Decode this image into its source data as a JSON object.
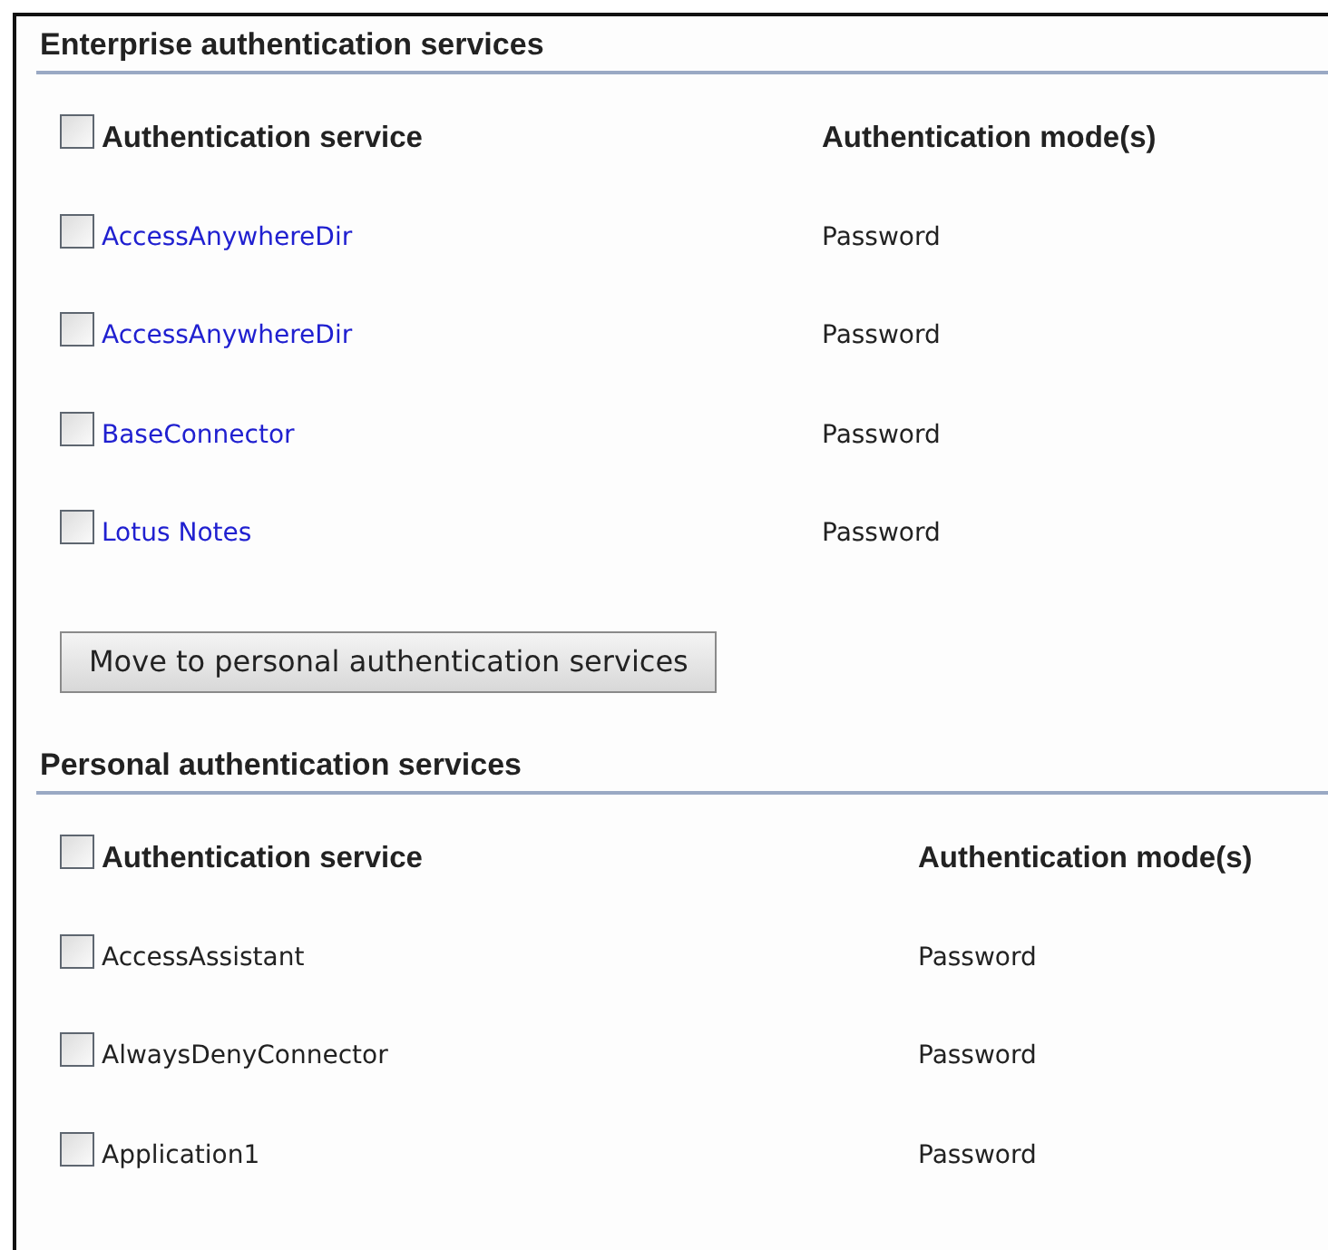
{
  "sections": [
    {
      "title": "Enterprise authentication services",
      "header": {
        "service": "Authentication service",
        "mode": "Authentication mode(s)",
        "checked": false
      },
      "rows": [
        {
          "service": "AccessAnywhereDir",
          "mode": "Password",
          "kind": "link",
          "checked": false
        },
        {
          "service": "AccessAnywhereDir",
          "mode": "Password",
          "kind": "link",
          "checked": false
        },
        {
          "service": "BaseConnector",
          "mode": "Password",
          "kind": "link",
          "checked": false
        },
        {
          "service": "Lotus Notes",
          "mode": "Password",
          "kind": "link",
          "checked": false
        }
      ],
      "button": "Move to personal authentication services"
    },
    {
      "title": "Personal authentication services",
      "header": {
        "service": "Authentication service",
        "mode": "Authentication mode(s)",
        "checked": false
      },
      "rows": [
        {
          "service": "AccessAssistant",
          "mode": "Password",
          "kind": "text",
          "checked": false
        },
        {
          "service": "AlwaysDenyConnector",
          "mode": "Password",
          "kind": "text",
          "checked": false
        },
        {
          "service": "Application1",
          "mode": "Password",
          "kind": "text",
          "checked": false
        }
      ]
    }
  ]
}
